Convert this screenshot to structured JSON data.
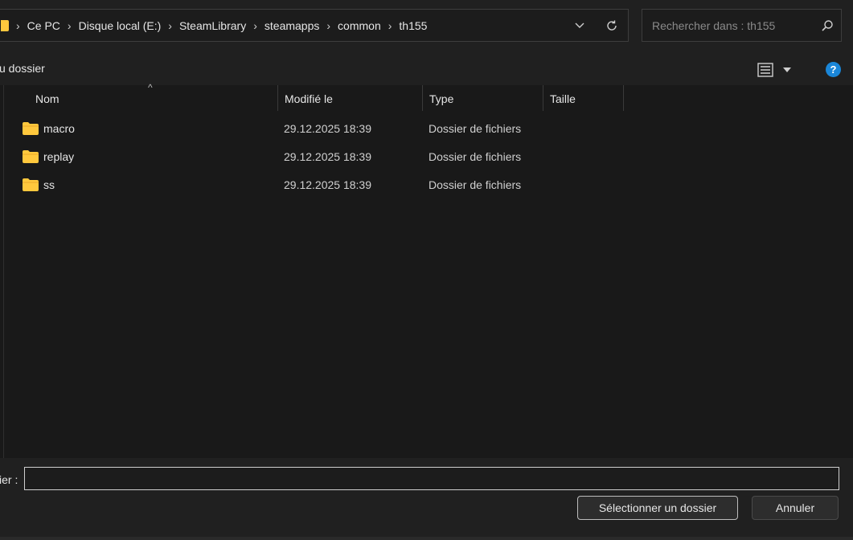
{
  "address": {
    "crumbs": [
      "Ce PC",
      "Disque local (E:)",
      "SteamLibrary",
      "steamapps",
      "common",
      "th155"
    ]
  },
  "search": {
    "placeholder": "Rechercher dans : th155",
    "value": ""
  },
  "commands": {
    "new_folder_label": "u dossier"
  },
  "columns": {
    "name": "Nom",
    "modified": "Modifié le",
    "type": "Type",
    "size": "Taille"
  },
  "files": [
    {
      "name": "macro",
      "modified": "29.12.2025 18:39",
      "type": "Dossier de fichiers",
      "size": ""
    },
    {
      "name": "replay",
      "modified": "29.12.2025 18:39",
      "type": "Dossier de fichiers",
      "size": ""
    },
    {
      "name": "ss",
      "modified": "29.12.2025 18:39",
      "type": "Dossier de fichiers",
      "size": ""
    }
  ],
  "footer": {
    "filename_label": "ier :",
    "filename_value": "",
    "select_button": "Sélectionner un dossier",
    "cancel_button": "Annuler"
  },
  "icons": {
    "folder": "folder-icon",
    "search": "search-icon",
    "refresh": "refresh-icon",
    "chevron": "chevron-down-icon",
    "view": "details-view-icon",
    "help": "help-icon"
  },
  "colors": {
    "folder": "#ffc83d",
    "help": "#1a86d8",
    "background": "#191919"
  }
}
